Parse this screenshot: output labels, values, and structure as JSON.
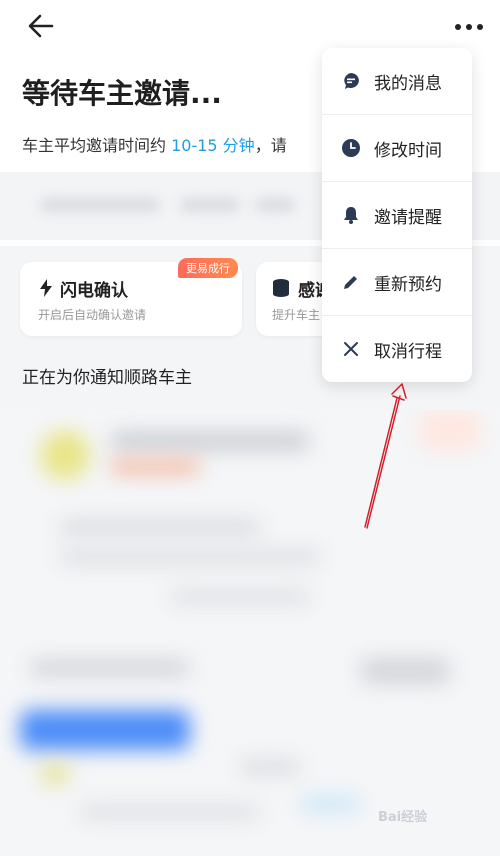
{
  "header": {
    "title": "等待车主邀请...",
    "subtitle_prefix": "车主平均邀请时间约 ",
    "subtitle_highlight": "10-15 分钟",
    "subtitle_suffix": "，请"
  },
  "cards": [
    {
      "title": "闪电确认",
      "subtitle": "开启后自动确认邀请",
      "badge": "更易成行",
      "icon": "lightning-icon"
    },
    {
      "title": "感谢",
      "subtitle": "提升车主",
      "icon": "coin-stack-icon"
    }
  ],
  "notify_text": "正在为你通知顺路车主",
  "menu": {
    "items": [
      {
        "label": "我的消息",
        "icon": "message-icon"
      },
      {
        "label": "修改时间",
        "icon": "clock-icon"
      },
      {
        "label": "邀请提醒",
        "icon": "bell-icon"
      },
      {
        "label": "重新预约",
        "icon": "pencil-icon"
      },
      {
        "label": "取消行程",
        "icon": "close-icon"
      }
    ]
  },
  "watermark": "Bai经验",
  "colors": {
    "accent": "#1f9fe0",
    "badge": "#ff6b5a",
    "annotation": "#d0202a",
    "icon": "#2b3a55"
  }
}
